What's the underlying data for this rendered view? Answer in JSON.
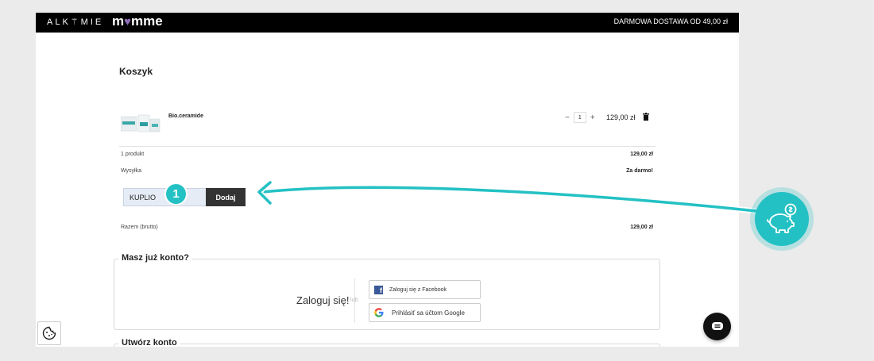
{
  "header": {
    "brand_left": "ALK⚚MIE",
    "brand_right_prefix": "m",
    "brand_right_heart": "♥",
    "brand_right_suffix": "mme",
    "shipping_banner": "DARMOWA DOSTAWA OD 49,00 zł"
  },
  "cart": {
    "title": "Koszyk",
    "item": {
      "name": "Bio.ceramide",
      "quantity": "1",
      "minus_label": "−",
      "plus_label": "+",
      "price": "129,00 zł"
    },
    "summary": {
      "products_label": "1 produkt",
      "products_value": "129,00 zł",
      "shipping_label": "Wysyłka",
      "shipping_value": "Za darmo!",
      "total_label": "Razem (brutto)",
      "total_value": "129,00 zł"
    },
    "coupon": {
      "value": "KUPLIO",
      "button_label": "Dodaj"
    }
  },
  "account": {
    "title": "Masz już konto?",
    "login_text": "Zaloguj się!",
    "or_text": "lub",
    "facebook_label": "Zaloguj się z Facebook",
    "google_label": "Prihlásiť sa účtom Google"
  },
  "create_account": {
    "title": "Utwórz konto"
  },
  "annotation": {
    "step_number": "1"
  },
  "colors": {
    "accent_teal": "#24c1c4",
    "topbar": "#000000",
    "button_dark": "#333333",
    "facebook": "#3b5998"
  },
  "icons": {
    "trash": "trash-icon",
    "chat": "chat-icon",
    "cookie": "cookie-icon",
    "piggy": "piggy-bank-icon",
    "facebook": "facebook-icon",
    "google": "google-icon"
  }
}
